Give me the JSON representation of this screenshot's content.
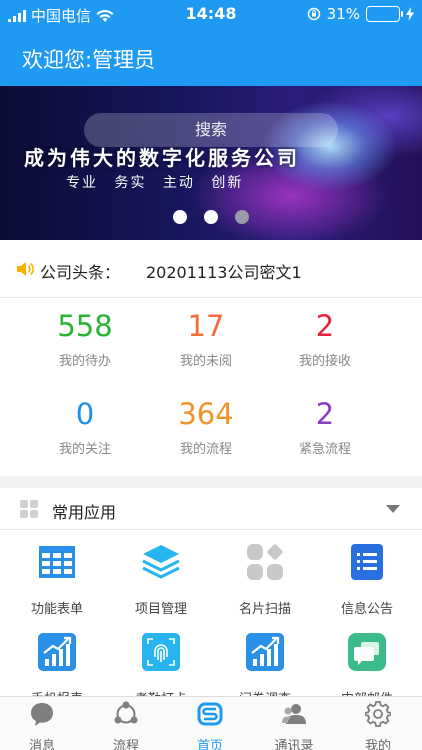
{
  "status_bar": {
    "carrier": "中国电信",
    "time": "14:48",
    "battery_text": "31%",
    "battery_level": 0.31
  },
  "header": {
    "welcome": "欢迎您:管理员"
  },
  "banner": {
    "search_placeholder": "搜索",
    "slogan": "成为伟大的数字化服务公司",
    "subtitle": "专业 务实 主动 创新",
    "dots_total": 3,
    "dots_active": 2
  },
  "headline": {
    "label": "公司头条：",
    "text": "20201113公司密文1"
  },
  "stats": [
    {
      "value": "558",
      "label": "我的待办",
      "color": "#29b533"
    },
    {
      "value": "17",
      "label": "我的未阅",
      "color": "#f26d3c"
    },
    {
      "value": "2",
      "label": "我的接收",
      "color": "#e8213a"
    },
    {
      "value": "0",
      "label": "我的关注",
      "color": "#1e8fe3"
    },
    {
      "value": "364",
      "label": "我的流程",
      "color": "#f0932b"
    },
    {
      "value": "2",
      "label": "紧急流程",
      "color": "#8b3cc7"
    }
  ],
  "apps": {
    "title": "常用应用",
    "items": [
      {
        "label": "功能表单",
        "icon": "table-icon"
      },
      {
        "label": "项目管理",
        "icon": "layers-icon"
      },
      {
        "label": "名片扫描",
        "icon": "card-scan-icon"
      },
      {
        "label": "信息公告",
        "icon": "notice-list-icon"
      },
      {
        "label": "手机报表",
        "icon": "chart-icon"
      },
      {
        "label": "考勤打卡",
        "icon": "fingerprint-icon"
      },
      {
        "label": "问卷调查",
        "icon": "chart-icon"
      },
      {
        "label": "内部邮件",
        "icon": "chat-bubbles-icon"
      }
    ]
  },
  "tabs": [
    {
      "label": "消息",
      "icon": "message-icon"
    },
    {
      "label": "流程",
      "icon": "flow-icon"
    },
    {
      "label": "首页",
      "icon": "home-logo-icon"
    },
    {
      "label": "通讯录",
      "icon": "contacts-icon"
    },
    {
      "label": "我的",
      "icon": "gear-icon"
    }
  ],
  "colors": {
    "primary": "#1f9af3",
    "icon_blue": "#2a8fe6",
    "icon_cyan": "#27b4f0",
    "icon_green": "#3cbb8a",
    "inactive_gray": "#888888"
  }
}
